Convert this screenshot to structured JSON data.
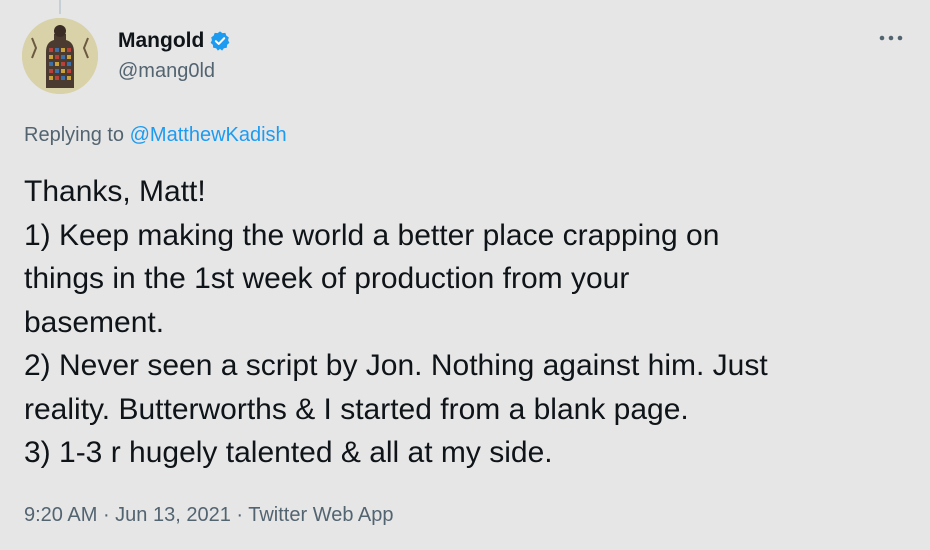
{
  "tweet": {
    "display_name": "Mangold",
    "handle": "@mang0ld",
    "verified": true,
    "avatar_icon": "avatar-illustration-icon",
    "more_icon": "more-options-icon",
    "replying_prefix": "Replying to ",
    "replying_to": "@MatthewKadish",
    "lines": [
      "Thanks, Matt!",
      "1) Keep making the world a better place crapping on",
      "things in the 1st week of production from your",
      "basement.",
      "2) Never seen a script by Jon. Nothing against him. Just",
      "reality. Butterworths & I started from a blank page.",
      "3) 1-3 r hugely talented & all at my side."
    ],
    "time": "9:20 AM",
    "date": "Jun 13, 2021",
    "separator": " · ",
    "source": "Twitter Web App"
  },
  "colors": {
    "background": "#e6e6e6",
    "text": "#0f1419",
    "secondary": "#536471",
    "accent": "#1d9bf0",
    "verified_badge": "#1d9bf0"
  }
}
